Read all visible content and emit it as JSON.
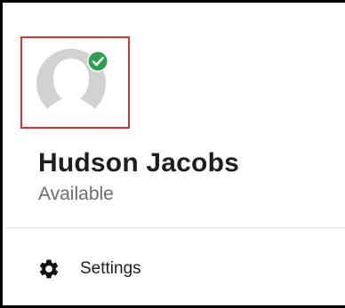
{
  "profile": {
    "name": "Hudson Jacobs",
    "status": "Available",
    "avatar_icon": "default-avatar-icon",
    "status_icon": "check-circle-icon",
    "status_color": "#2e9e4f",
    "selection_color": "#d9333a"
  },
  "menu": {
    "settings_label": "Settings",
    "settings_icon": "gear-icon"
  }
}
